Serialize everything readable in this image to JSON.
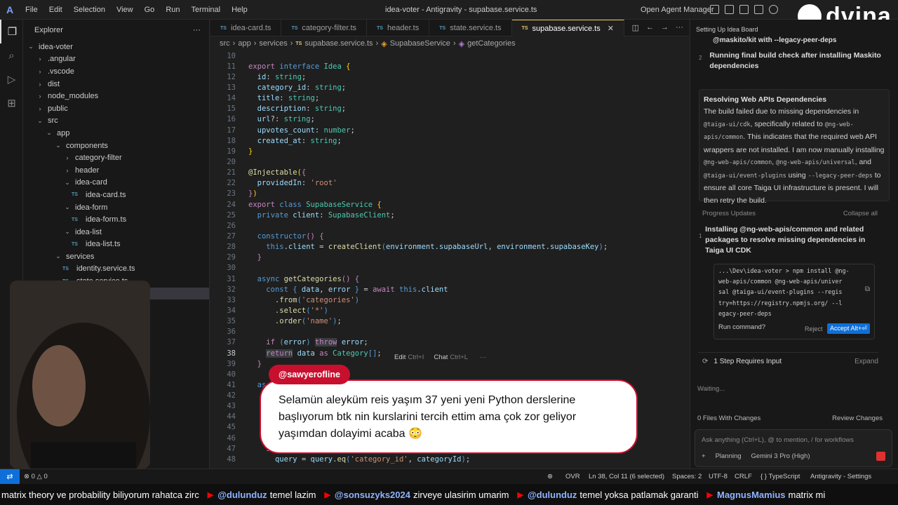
{
  "menubar": {
    "items": [
      "File",
      "Edit",
      "Selection",
      "View",
      "Go",
      "Run",
      "Terminal",
      "Help"
    ],
    "window_title": "idea-voter - Antigravity - supabase.service.ts",
    "agent_manager": "Open Agent Manager"
  },
  "sidebar": {
    "title": "Explorer",
    "tree": [
      {
        "label": "idea-voter",
        "indent": 0,
        "chev": "down"
      },
      {
        "label": ".angular",
        "indent": 1,
        "chev": "right"
      },
      {
        "label": ".vscode",
        "indent": 1,
        "chev": "right"
      },
      {
        "label": "dist",
        "indent": 1,
        "chev": "right"
      },
      {
        "label": "node_modules",
        "indent": 1,
        "chev": "right"
      },
      {
        "label": "public",
        "indent": 1,
        "chev": "right"
      },
      {
        "label": "src",
        "indent": 1,
        "chev": "down"
      },
      {
        "label": "app",
        "indent": 2,
        "chev": "down"
      },
      {
        "label": "components",
        "indent": 3,
        "chev": "down"
      },
      {
        "label": "category-filter",
        "indent": 4,
        "chev": "right"
      },
      {
        "label": "header",
        "indent": 4,
        "chev": "right"
      },
      {
        "label": "idea-card",
        "indent": 4,
        "chev": "down"
      },
      {
        "label": "idea-card.ts",
        "indent": 5,
        "ts": true
      },
      {
        "label": "idea-form",
        "indent": 4,
        "chev": "down"
      },
      {
        "label": "idea-form.ts",
        "indent": 5,
        "ts": true
      },
      {
        "label": "idea-list",
        "indent": 4,
        "chev": "down"
      },
      {
        "label": "idea-list.ts",
        "indent": 5,
        "ts": true
      },
      {
        "label": "services",
        "indent": 3,
        "chev": "down"
      },
      {
        "label": "identity.service.ts",
        "indent": 4,
        "ts": true
      },
      {
        "label": "state.service.ts",
        "indent": 4,
        "ts": true
      },
      {
        "label": "",
        "indent": 4,
        "selected": true
      }
    ]
  },
  "editor": {
    "tabs": [
      {
        "label": "idea-card.ts"
      },
      {
        "label": "category-filter.ts"
      },
      {
        "label": "header.ts"
      },
      {
        "label": "state.service.ts"
      },
      {
        "label": "supabase.service.ts",
        "active": true
      }
    ],
    "breadcrumb": [
      "src",
      "app",
      "services",
      "supabase.service.ts",
      "SupabaseService",
      "getCategories"
    ],
    "lines": [
      {
        "n": "10",
        "html": ""
      },
      {
        "n": "11",
        "html": "<span class='kw2'>export</span> <span class='kw'>interface</span> <span class='ty'>Idea</span> <span class='br'>{</span>"
      },
      {
        "n": "12",
        "html": "  <span class='pr'>id</span>: <span class='ty'>string</span>;"
      },
      {
        "n": "13",
        "html": "  <span class='pr'>category_id</span>: <span class='ty'>string</span>;"
      },
      {
        "n": "14",
        "html": "  <span class='pr'>title</span>: <span class='ty'>string</span>;"
      },
      {
        "n": "15",
        "html": "  <span class='pr'>description</span>: <span class='ty'>string</span>;"
      },
      {
        "n": "16",
        "html": "  <span class='pr'>url</span>?: <span class='ty'>string</span>;"
      },
      {
        "n": "17",
        "html": "  <span class='pr'>upvotes_count</span>: <span class='ty'>number</span>;"
      },
      {
        "n": "18",
        "html": "  <span class='pr'>created_at</span>: <span class='ty'>string</span>;"
      },
      {
        "n": "19",
        "html": "<span class='br'>}</span>"
      },
      {
        "n": "20",
        "html": ""
      },
      {
        "n": "21",
        "html": "<span class='dec'>@Injectable</span><span class='br'>(</span><span class='kw2'>{</span>"
      },
      {
        "n": "22",
        "html": "  <span class='pr'>providedIn</span>: <span class='st'>'root'</span>"
      },
      {
        "n": "23",
        "html": "<span class='kw2'>}</span><span class='br'>)</span>"
      },
      {
        "n": "24",
        "html": "<span class='kw2'>export</span> <span class='kw'>class</span> <span class='ty'>SupabaseService</span> <span class='br'>{</span>"
      },
      {
        "n": "25",
        "html": "  <span class='kw'>private</span> <span class='pr'>client</span>: <span class='ty'>SupabaseClient</span>;"
      },
      {
        "n": "26",
        "html": ""
      },
      {
        "n": "27",
        "html": "  <span class='kw'>constructor</span><span class='kw2'>()</span> <span class='kw2'>{</span>"
      },
      {
        "n": "28",
        "html": "    <span class='kw'>this</span>.<span class='pr'>client</span> = <span class='fn'>createClient</span><span class='kw'>(</span><span class='pr'>environment</span>.<span class='pr'>supabaseUrl</span>, <span class='pr'>environment</span>.<span class='pr'>supabaseKey</span><span class='kw'>)</span>;"
      },
      {
        "n": "29",
        "html": "  <span class='kw2'>}</span>"
      },
      {
        "n": "30",
        "html": ""
      },
      {
        "n": "31",
        "html": "  <span class='kw'>async</span> <span class='fn'>getCategories</span><span class='kw2'>()</span> <span class='kw2'>{</span>"
      },
      {
        "n": "32",
        "html": "    <span class='kw'>const</span> <span class='kw'>{</span> <span class='pr'>data</span>, <span class='pr'>error</span> <span class='kw'>}</span> = <span class='kw2'>await</span> <span class='kw'>this</span>.<span class='pr'>client</span>"
      },
      {
        "n": "33",
        "html": "      .<span class='fn'>from</span><span class='kw'>(</span><span class='st'>'categories'</span><span class='kw'>)</span>"
      },
      {
        "n": "34",
        "html": "      .<span class='fn'>select</span><span class='kw'>(</span><span class='st'>'*'</span><span class='kw'>)</span>"
      },
      {
        "n": "35",
        "html": "      .<span class='fn'>order</span><span class='kw'>(</span><span class='st'>'name'</span><span class='kw'>)</span>;"
      },
      {
        "n": "36",
        "html": ""
      },
      {
        "n": "37",
        "html": "    <span class='kw2'>if</span> <span class='kw'>(</span><span class='pr'>error</span><span class='kw'>)</span> <span class='kw2' style='background:#3a3d41'>throw</span> <span class='pr'>error</span>;"
      },
      {
        "n": "38",
        "html": "    <span class='kw2' style='background:#3a3d41'>return</span> <span class='pr'>data</span> <span class='kw2'>as</span> <span class='ty'>Category</span><span class='kw'>[]</span>;",
        "cur": true
      },
      {
        "n": "39",
        "html": "  <span class='kw2'>}</span>"
      },
      {
        "n": "40",
        "html": ""
      },
      {
        "n": "41",
        "html": "  <span class='kw'>as</span>"
      },
      {
        "n": "42",
        "html": ""
      },
      {
        "n": "43",
        "html": ""
      },
      {
        "n": "44",
        "html": ""
      },
      {
        "n": "45",
        "html": ""
      },
      {
        "n": "46",
        "html": ""
      },
      {
        "n": "47",
        "html": "    <span class='kw2'>i</span>"
      },
      {
        "n": "48",
        "html": "      <span class='pr'>query</span> = <span class='pr'>query</span>.<span class='fn'>eq</span><span class='kw'>(</span><span class='st'>'category_id'</span>, <span class='pr'>categoryId</span><span class='kw'>)</span>;"
      }
    ],
    "hint_edit": "Edit",
    "hint_edit_key": "Ctrl+I",
    "hint_chat": "Chat",
    "hint_chat_key": "Ctrl+L",
    "hint_more": "···"
  },
  "agent_panel": {
    "title": "Setting Up Idea Board",
    "prev_step_text": "@maskito/kit with --legacy-peer-deps",
    "step2_num": "2",
    "step2_text": "Running final build check after installing Maskito dependencies",
    "card_title": "Resolving Web APIs Dependencies",
    "card_p1": "The build failed due to missing dependencies in",
    "card_code1": "@taiga-ui/cdk",
    "card_p2": ", specifically related to",
    "card_code2": "@ng-web-apis/common",
    "card_p3": ". This indicates that the required web API wrappers are not installed. I am now manually installing",
    "card_code3": "@ng-web-apis/common",
    "card_code4": "@ng-web-apis/universal",
    "card_p4": ", and",
    "card_code5": "@taiga-ui/event-plugins",
    "card_p5": "using",
    "card_code6": "--legacy-peer-deps",
    "card_p6": "to ensure all core Taiga UI infrastructure is present. I will then retry the build.",
    "progress_label": "Progress Updates",
    "collapse_all": "Collapse all",
    "prog_step_num": "1",
    "prog_step_text": "Installing @ng-web-apis/common and related packages to resolve missing dependencies in Taiga UI CDK",
    "cmd_lines": [
      "...\\Dev\\idea-voter > npm install @ng-",
      "web-apis/common @ng-web-apis/univer",
      "sal @taiga-ui/event-plugins --regis",
      "try=https://registry.npmjs.org/ --l",
      "egacy-peer-deps"
    ],
    "run_command": "Run command?",
    "reject": "Reject",
    "accept": "Accept Alt+⏎",
    "requires_input": "1 Step Requires Input",
    "expand": "Expand",
    "waiting": "Waiting...",
    "files_changes": "0 Files With Changes",
    "review_changes": "Review Changes",
    "chat_placeholder": "Ask anything (Ctrl+L), @ to mention, / for workflows",
    "mode": "Planning",
    "model": "Gemini 3 Pro (High)"
  },
  "statusbar": {
    "problems": "⊗ 0 △ 0",
    "ovr": "OVR",
    "position": "Ln 38, Col 11 (6 selected)",
    "spaces": "Spaces: 2",
    "encoding": "UTF-8",
    "eol": "CRLF",
    "language": "{ } TypeScript",
    "settings": "Antigravity - Settings"
  },
  "ticker": {
    "t0": "matrix theory ve probability biliyorum rahatca zirc",
    "u1": "@dulunduz",
    "t1": "temel lazim",
    "u2": "@sonsuzyks2024",
    "t2": "zirveye ulasirim umarim",
    "u3": "@dulunduz",
    "t3": "temel yoksa patlamak garanti",
    "u4": "MagnusMamius",
    "t4": "matrix mi"
  },
  "overlay": {
    "username": "@sawyerofline",
    "message": "Selamün aleyküm reis yaşım 37 yeni yeni Python derslerine başlıyorum btk nin kurslarini tercih ettim ama çok zor geliyor yaşımdan dolayimi acaba 😳"
  },
  "brand": {
    "name": "dvina"
  }
}
